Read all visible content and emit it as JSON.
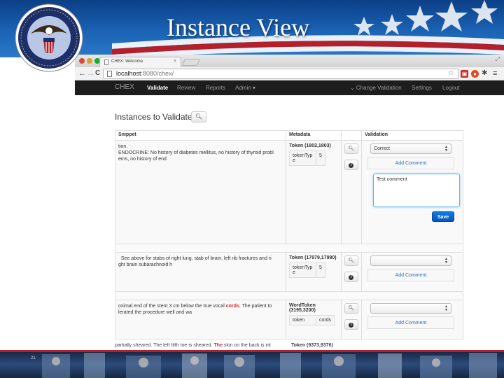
{
  "slide": {
    "title": "Instance View",
    "page_number": "21",
    "colors": {
      "header_blue": "#1b63b5",
      "footer_navy": "#15233e",
      "accent_red": "#b31f2b"
    }
  },
  "browser": {
    "tab_title": "CHEX: Welcome",
    "tab_close": "×",
    "url_host": "localhost",
    "url_path": ":8080/chex/",
    "back": "←",
    "forward": "→",
    "reload": "C",
    "bookmark": "☆",
    "menu": "≡",
    "settings": "✱"
  },
  "navbar": {
    "brand": "CHEX",
    "items": [
      "Validate",
      "Review",
      "Reports",
      "Admin ▾"
    ],
    "right_items": [
      "⌄ Change Validation",
      "Settings",
      "Logout"
    ]
  },
  "page": {
    "heading": "Instances to Validate",
    "columns": {
      "snippet": "Snippet",
      "metadata": "Metadata",
      "validation": "Validation"
    }
  },
  "rows": [
    {
      "snippet_lines": [
        "tion.",
        "ENDOCRINE:  No history of diabetes mellitus, no history of thyroid probl",
        "ems, no history of end"
      ],
      "meta_title": "Token (1802,1803)",
      "meta_key": "tokenType",
      "meta_val": "5",
      "select_value": "Correct",
      "add_comment": "Add Comment",
      "comment_text": "Test comment",
      "save_label": "Save"
    },
    {
      "snippet_lines": [
        "  See above for stabs of right lung, stab of brain, left rib fractures and ri",
        "ght brain subarachnoid h"
      ],
      "meta_title": "Token (17979,17980)",
      "meta_key": "tokenType",
      "meta_val": "5",
      "select_value": "",
      "add_comment": "Add Comment"
    },
    {
      "snippet_pre": "oximal end of the stent 3 cm below the true vocal ",
      "snippet_hl": "cords",
      "snippet_post": ".  The patient to",
      "snippet_line2": "lerated the procedure well and wa",
      "meta_title_1": "WordToken",
      "meta_title_2": "(3195,3200)",
      "meta_key": "token",
      "meta_val": "cords",
      "select_value": "",
      "add_comment": "Add Comment"
    }
  ],
  "partial_row": {
    "text_pre": "partially sheared.  The left fifth toe is sheared.  ",
    "text_hl": "The",
    "text_post": " skin on the back is int",
    "meta": "Token (9373,9376)"
  }
}
